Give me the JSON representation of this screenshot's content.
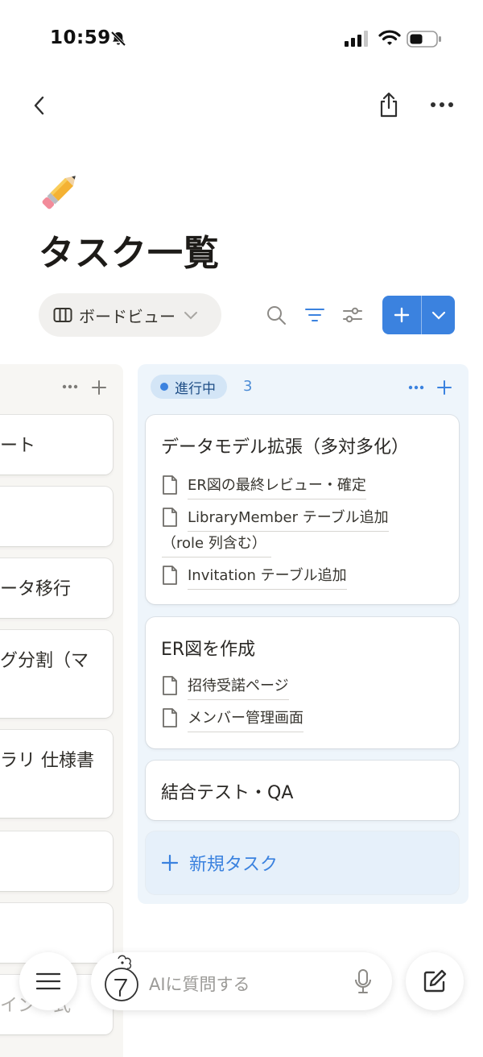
{
  "status_bar": {
    "time": "10:59"
  },
  "page": {
    "title": "タスク一覧"
  },
  "view": {
    "label": "ボードビュー"
  },
  "left_column": {
    "cards": [
      "ート",
      "",
      "ータ移行",
      "グ分割（マ",
      "ラリ 仕様書",
      "",
      "",
      "イン一式"
    ]
  },
  "column": {
    "status": "進行中",
    "count": "3",
    "accent": "#3b82df",
    "cards": [
      {
        "title": "データモデル拡張（多対多化）",
        "subtasks": [
          "ER図の最終レビュー・確定",
          "LibraryMember テーブル追加",
          "（role 列含む）",
          "Invitation テーブル追加"
        ]
      },
      {
        "title": "ER図を作成",
        "subtasks": [
          "招待受諾ページ",
          "メンバー管理画面"
        ]
      },
      {
        "title": "結合テスト・QA",
        "subtasks": []
      }
    ],
    "new_task": "新規タスク"
  },
  "bottom": {
    "ai_placeholder": "AIに質問する"
  },
  "icons": {
    "back": "chevron-left-icon",
    "share": "share-icon",
    "more": "more-icon",
    "search": "search-icon",
    "filter": "filter-icon",
    "sort": "sliders-icon"
  }
}
